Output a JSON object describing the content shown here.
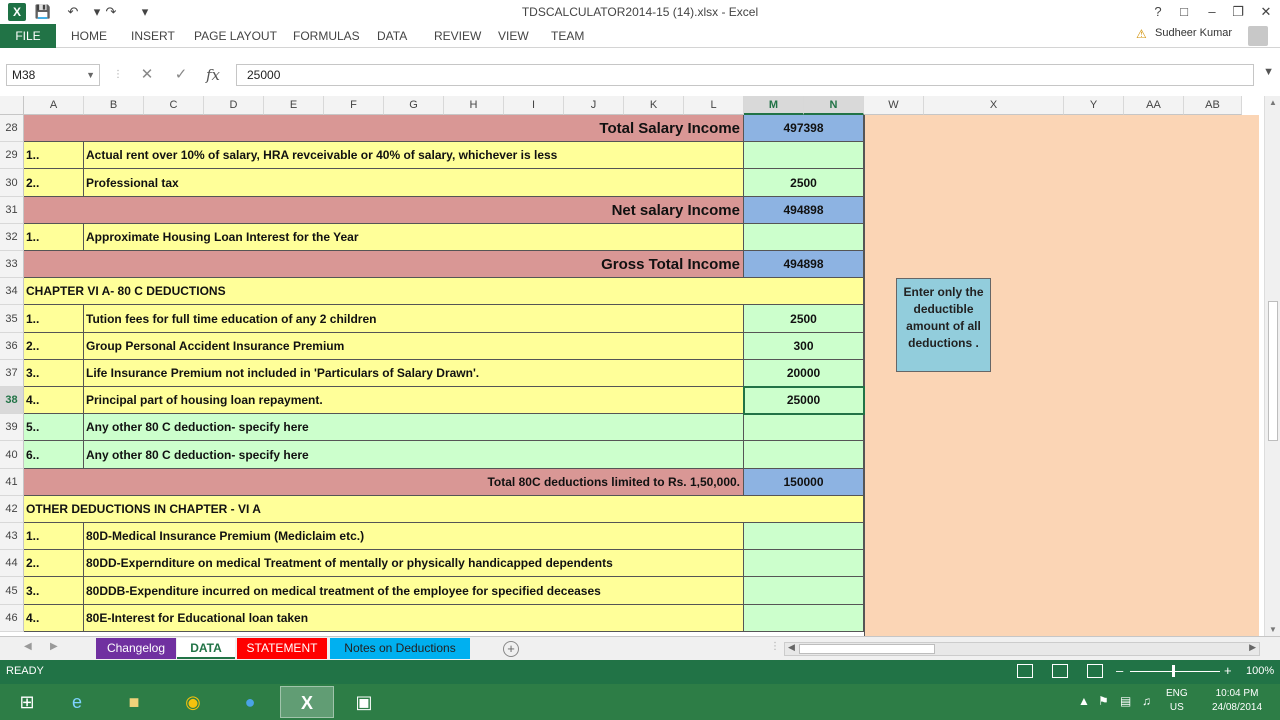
{
  "window": {
    "title": "TDSCALCULATOR2014-15 (14).xlsx - Excel",
    "help": "?",
    "user": "Sudheer Kumar"
  },
  "ribbon": {
    "file": "FILE",
    "tabs": [
      "HOME",
      "INSERT",
      "PAGE LAYOUT",
      "FORMULAS",
      "DATA",
      "REVIEW",
      "VIEW",
      "TEAM"
    ]
  },
  "formula_bar": {
    "name_box": "M38",
    "value": "25000"
  },
  "columns": [
    "A",
    "B",
    "C",
    "D",
    "E",
    "F",
    "G",
    "H",
    "I",
    "J",
    "K",
    "L",
    "M",
    "N",
    "W",
    "X",
    "Y",
    "AA",
    "AB"
  ],
  "rows": [
    {
      "num": "28",
      "type": "total",
      "label": "Total Salary Income",
      "value": "497398"
    },
    {
      "num": "29",
      "type": "item",
      "sn": "1..",
      "label": "Actual rent over 10% of salary, HRA revceivable or 40% of salary, whichever is less",
      "value": ""
    },
    {
      "num": "30",
      "type": "item",
      "sn": "2..",
      "label": "Professional tax",
      "value": "2500"
    },
    {
      "num": "31",
      "type": "total",
      "label": "Net salary Income",
      "value": "494898"
    },
    {
      "num": "32",
      "type": "item",
      "sn": "1..",
      "label": "Approximate Housing Loan Interest for the Year",
      "value": ""
    },
    {
      "num": "33",
      "type": "total",
      "label": "Gross Total Income",
      "value": "494898"
    },
    {
      "num": "34",
      "type": "header",
      "label": "CHAPTER VI A- 80 C DEDUCTIONS"
    },
    {
      "num": "35",
      "type": "item",
      "sn": "1..",
      "label": "Tution fees for full time education of any 2 children",
      "value": "2500"
    },
    {
      "num": "36",
      "type": "item",
      "sn": "2..",
      "label": "Group Personal Accident Insurance Premium",
      "value": "300"
    },
    {
      "num": "37",
      "type": "item",
      "sn": "3..",
      "label": "Life Insurance Premium not included in 'Particulars of Salary Drawn'.",
      "value": "20000"
    },
    {
      "num": "38",
      "type": "item",
      "sn": "4..",
      "label": "Principal part of housing loan repayment.",
      "value": "25000"
    },
    {
      "num": "39",
      "type": "item-green",
      "sn": "5..",
      "label": "Any other 80 C deduction- specify here",
      "value": ""
    },
    {
      "num": "40",
      "type": "item-green",
      "sn": "6..",
      "label": "Any other 80 C deduction- specify here",
      "value": ""
    },
    {
      "num": "41",
      "type": "total-small",
      "label": "Total 80C deductions limited to Rs. 1,50,000.",
      "value": "150000"
    },
    {
      "num": "42",
      "type": "header",
      "label": "OTHER DEDUCTIONS IN CHAPTER - VI A"
    },
    {
      "num": "43",
      "type": "item",
      "sn": "1..",
      "label": "80D-Medical Insurance Premium (Mediclaim etc.)",
      "value": ""
    },
    {
      "num": "44",
      "type": "item",
      "sn": "2..",
      "label": "80DD-Expernditure on medical Treatment of mentally or physically handicapped dependents",
      "value": ""
    },
    {
      "num": "45",
      "type": "item",
      "sn": "3..",
      "label": "80DDB-Expenditure incurred on medical treatment of the employee for specified deceases",
      "value": ""
    },
    {
      "num": "46",
      "type": "item",
      "sn": "4..",
      "label": "80E-Interest for Educational loan taken",
      "value": ""
    }
  ],
  "note": "Enter only the deductible amount of all deductions .",
  "sheet_tabs": [
    "Changelog",
    "DATA",
    "STATEMENT",
    "Notes on Deductions"
  ],
  "status": {
    "ready": "READY",
    "zoom": "100%"
  },
  "taskbar": {
    "lang": "ENG",
    "region": "US",
    "time": "10:04 PM",
    "date": "24/08/2014"
  },
  "colors": {
    "excel_green": "#217346",
    "salmon": "#d99795",
    "yellow": "#ffff99",
    "green": "#ccffcc",
    "blue": "#8db3e2",
    "peach": "#fbd5b5",
    "note": "#92cddc"
  }
}
